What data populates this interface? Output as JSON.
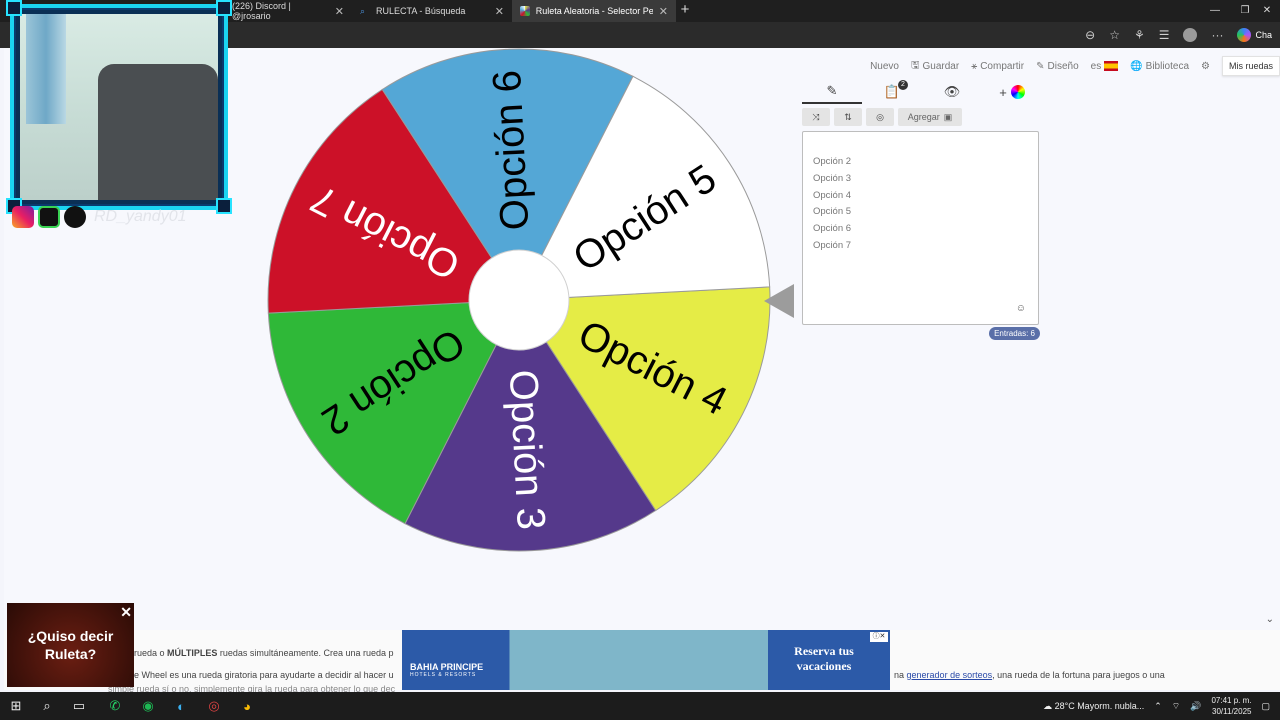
{
  "browser": {
    "tabs": [
      {
        "title": "(226) Discord | @jrosario",
        "active": false
      },
      {
        "title": "RULECTA - Búsqueda",
        "active": false
      },
      {
        "title": "Ruleta Aleatoria - Selector Person",
        "active": true
      }
    ],
    "copilot_label": "Cha",
    "window_controls": [
      "—",
      "❐",
      "✕"
    ]
  },
  "nav": {
    "nuevo": "Nuevo",
    "guardar": "Guardar",
    "compartir": "Compartir",
    "diseno": "Diseño",
    "language": "es",
    "biblioteca": "Biblioteca",
    "mis_ruedas": "Mis ruedas"
  },
  "panel": {
    "tabs": [
      "pencil-icon",
      "clipboard-icon",
      "hide-icon",
      "add-color-icon"
    ],
    "results_badge": "2",
    "add_label": "Agregar",
    "entries": [
      "Opción 2",
      "Opción 3",
      "Opción 4",
      "Opción 5",
      "Opción 6",
      "Opción 7"
    ],
    "count_label": "Entradas: 6"
  },
  "wheel": {
    "segments": [
      {
        "label": "Opción 4",
        "color": "#e5ec46",
        "text_color": "#000000"
      },
      {
        "label": "Opción 3",
        "color": "#55398b",
        "text_color": "#ffffff"
      },
      {
        "label": "Opción 2",
        "color": "#2fb838",
        "text_color": "#000000"
      },
      {
        "label": "Opción 7",
        "color": "#cc1128",
        "text_color": "#ffffff"
      },
      {
        "label": "Opción 6",
        "color": "#54a7d6",
        "text_color": "#000000"
      },
      {
        "label": "Opción 5",
        "color": "#ffffff",
        "text_color": "#000000"
      }
    ]
  },
  "overlay": {
    "social_name": "RD_yandy01"
  },
  "bottom": {
    "line1_prefix": "rueda o",
    "line1_bold": "MÚLTIPLES",
    "line1_rest": "ruedas simultáneamente. Crea una rueda p",
    "line2": "e Wheel es una rueda giratoria para ayudarte a decidir al hacer u",
    "line2_right_prefix": "na",
    "line2_right_link": "generador de sorteos",
    "line2_right_rest": ", una rueda de la fortuna para juegos o una",
    "line3": "simple rueda sí o no, simplemente gira la rueda para obtener lo que dec"
  },
  "ad": {
    "brand": "BAHIA PRINCIPE",
    "brand_sub": "HOTELS & RESORTS",
    "cta": "Reserva tus vacaciones"
  },
  "popup": {
    "text": "¿Quiso decir Ruleta?"
  },
  "taskbar": {
    "weather": "28°C  Mayorm. nubla...",
    "time": "07:41 p. m.",
    "date": "30/11/2025"
  }
}
